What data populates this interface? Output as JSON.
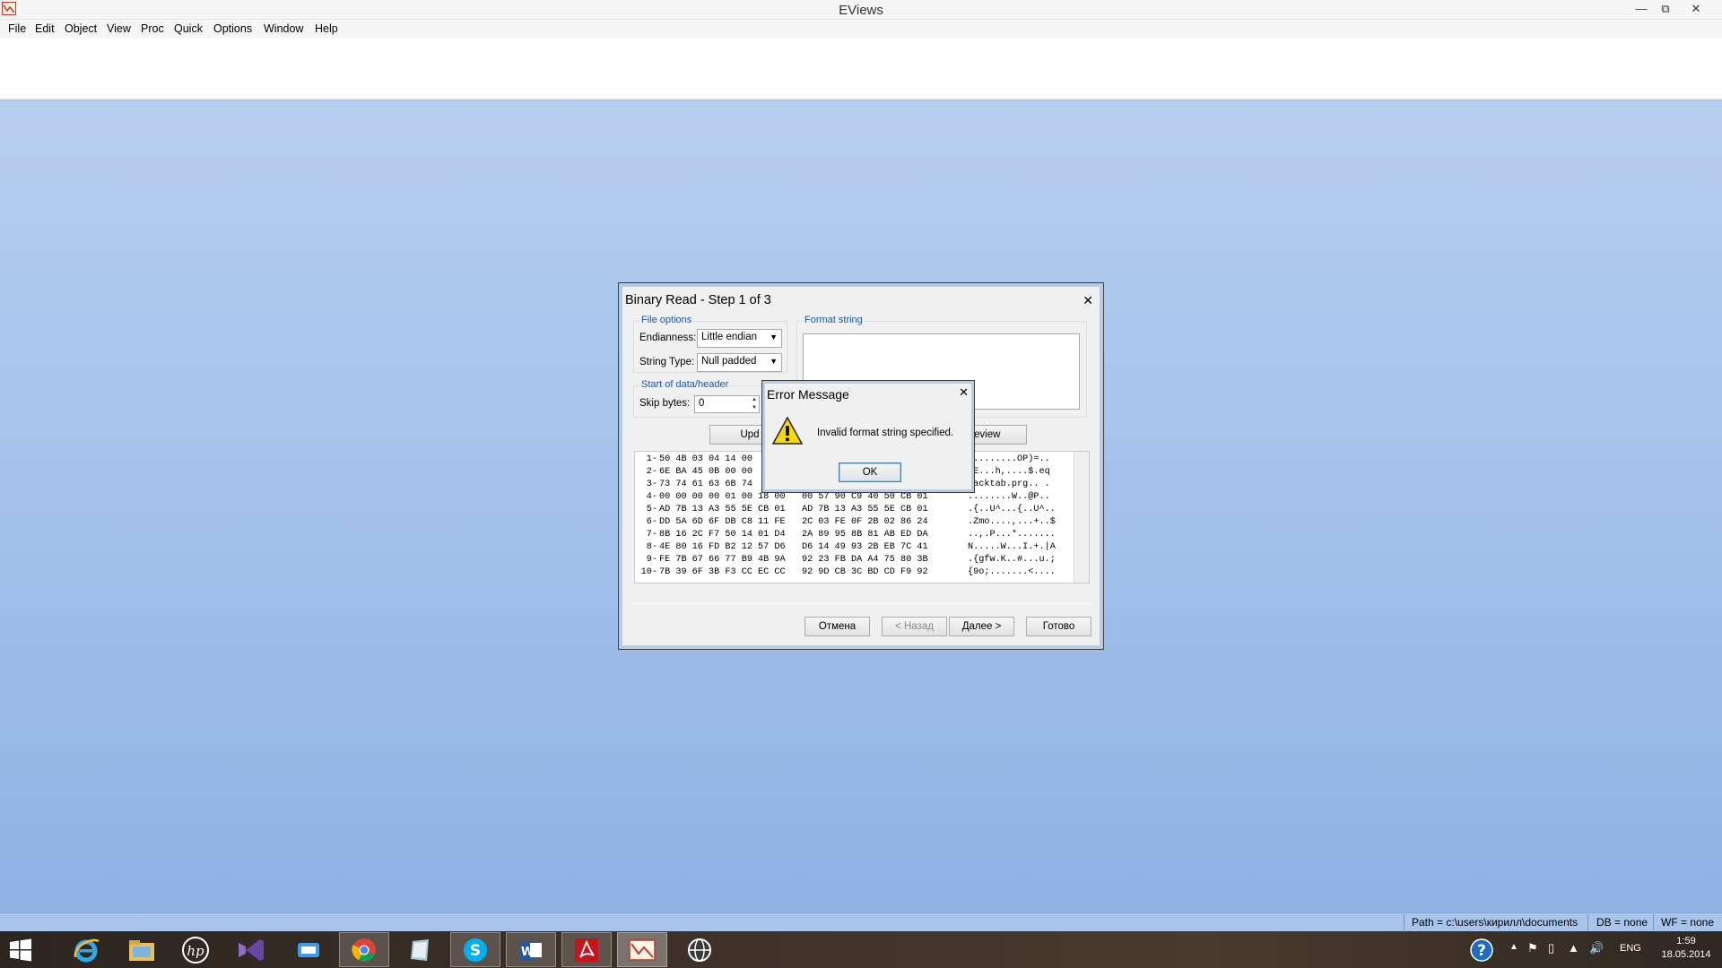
{
  "app": {
    "title": "EViews"
  },
  "menu": [
    "File",
    "Edit",
    "Object",
    "View",
    "Proc",
    "Quick",
    "Options",
    "Window",
    "Help"
  ],
  "status": {
    "path": "Path = c:\\users\\кирилл\\documents",
    "db": "DB = none",
    "wf": "WF = none"
  },
  "dialog": {
    "title": "Binary Read - Step 1 of 3",
    "file_options": {
      "label": "File options",
      "endianness_label": "Endianness:",
      "endianness_value": "Little endian",
      "string_type_label": "String Type:",
      "string_type_value": "Null padded"
    },
    "format_string": {
      "label": "Format string",
      "value": ""
    },
    "start": {
      "label": "Start of data/header",
      "skip_label": "Skip bytes:",
      "skip_value": "0"
    },
    "update_button": "Upd",
    "preview_button": "eview",
    "hex_rows": [
      {
        "n": "1-",
        "hex": "50 4B 03 04 14 00",
        "ascii": "K........OP)=.."
      },
      {
        "n": "2-",
        "hex": "6E BA 45 0B 00 00",
        "ascii": ".E...h,....$.eq"
      },
      {
        "n": "3-",
        "hex": "73 74 61 63 6B 74",
        "ascii": "tacktab.prg.. ."
      },
      {
        "n": "4-",
        "hex": "00 00 00 00 01 00 18 00   00 57 90 C9 40 50 CB 01",
        "ascii": "........W..@P.."
      },
      {
        "n": "5-",
        "hex": "AD 7B 13 A3 55 5E CB 01   AD 7B 13 A3 55 5E CB 01",
        "ascii": ".{..U^...{..U^.."
      },
      {
        "n": "6-",
        "hex": "DD 5A 6D 6F DB C8 11 FE   2C 03 FE 0F 2B 02 86 24",
        "ascii": ".Zmo....,...+..$"
      },
      {
        "n": "7-",
        "hex": "8B 16 2C F7 50 14 01 D4   2A 89 95 8B 81 AB ED DA",
        "ascii": "..,.P...*......."
      },
      {
        "n": "8-",
        "hex": "4E 80 16 FD B2 12 57 D6   D6 14 49 93 2B EB 7C 41",
        "ascii": "N.....W...I.+.|A"
      },
      {
        "n": "9-",
        "hex": "FE 7B 67 66 77 B9 4B 9A   92 23 FB DA A4 75 80 3B",
        "ascii": ".{gfw.K..#...u.;"
      },
      {
        "n": "10-",
        "hex": "7B 39 6F 3B F3 CC EC CC   92 9D CB 3C BD CD F9 92",
        "ascii": "{9o;.......<...."
      }
    ],
    "buttons": {
      "cancel": "Отмена",
      "back": "< Назад",
      "next": "Далее >",
      "finish": "Готово"
    }
  },
  "error": {
    "title": "Error Message",
    "message": "Invalid format string specified.",
    "ok": "OK"
  },
  "tray": {
    "lang": "ENG",
    "time": "1:59",
    "date": "18.05.2014"
  }
}
